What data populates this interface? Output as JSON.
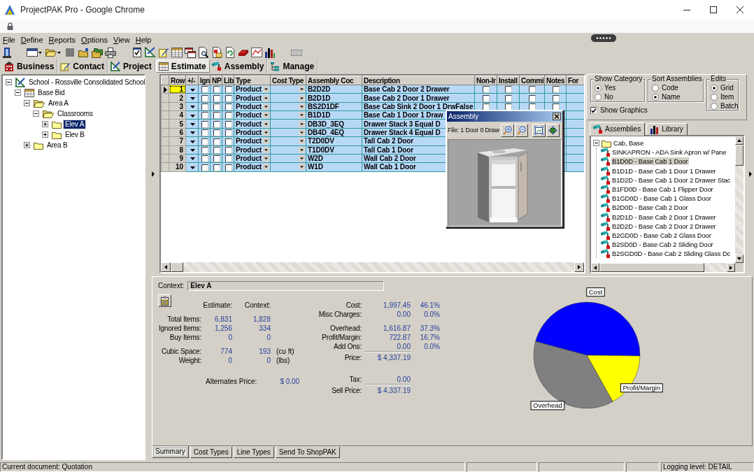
{
  "window": {
    "title": "ProjectPAK Pro - Google Chrome"
  },
  "menu": [
    "File",
    "Define",
    "Reports",
    "Options",
    "View",
    "Help"
  ],
  "module_tabs": [
    {
      "label": "Business",
      "selected": false
    },
    {
      "label": "Contact",
      "selected": false
    },
    {
      "label": "Project",
      "selected": false
    },
    {
      "label": "Estimate",
      "selected": true
    },
    {
      "label": "Assembly",
      "selected": false
    },
    {
      "label": "Manage",
      "selected": false
    }
  ],
  "project_tree": [
    {
      "label": "School - Rossville Consolidated School",
      "kind": "project",
      "expanded": true,
      "selected": false,
      "children": [
        {
          "label": "Base Bid",
          "kind": "estimate",
          "expanded": true,
          "selected": false,
          "children": [
            {
              "label": "Area A",
              "kind": "folder",
              "expanded": true,
              "selected": false,
              "children": [
                {
                  "label": "Classrooms",
                  "kind": "folder",
                  "expanded": true,
                  "selected": false,
                  "children": [
                    {
                      "label": "Elev A",
                      "kind": "folder",
                      "expanded": false,
                      "selected": true
                    },
                    {
                      "label": "Elev B",
                      "kind": "folder",
                      "expanded": false,
                      "selected": false
                    }
                  ]
                }
              ]
            },
            {
              "label": "Area B",
              "kind": "folder",
              "expanded": false,
              "selected": false
            }
          ]
        }
      ]
    }
  ],
  "grid": {
    "columns": [
      "Row",
      "+/-",
      "Ign",
      "NP",
      "Lib",
      "Type",
      "Cost Type",
      "Assembly Coc",
      "Description",
      "Non-Ir",
      "Install",
      "Commi",
      "Notes",
      "For"
    ],
    "rows": [
      {
        "row": "1",
        "selected": true,
        "ign": false,
        "np": false,
        "lib": false,
        "type": "Product",
        "code": "B2D2D",
        "description": "Base Cab 2 Door 2 Drawer",
        "flags": [
          false,
          false,
          false,
          false
        ]
      },
      {
        "row": "2",
        "selected": false,
        "ign": false,
        "np": false,
        "lib": false,
        "type": "Product",
        "code": "B2D1D",
        "description": "Base Cab 2 Door 1 Drawer",
        "flags": [
          false,
          false,
          false,
          false
        ]
      },
      {
        "row": "3",
        "selected": false,
        "ign": false,
        "np": false,
        "lib": false,
        "type": "Product",
        "code": "BS2D1DF",
        "description": "Base Cab Sink 2 Door 1 DrwFalse",
        "flags": [
          false,
          false,
          false,
          false
        ]
      },
      {
        "row": "4",
        "selected": false,
        "ign": false,
        "np": false,
        "lib": false,
        "type": "Product",
        "code": "B1D1D",
        "description": "Base Cab 1 Door 1 Draw"
      },
      {
        "row": "5",
        "selected": false,
        "ign": false,
        "np": false,
        "lib": false,
        "type": "Product",
        "code": "DB3D_3EQ",
        "description": "Drawer Stack 3 Equal D"
      },
      {
        "row": "6",
        "selected": false,
        "ign": false,
        "np": false,
        "lib": false,
        "type": "Product",
        "code": "DB4D_4EQ",
        "description": "Drawer Stack 4 Equal D"
      },
      {
        "row": "7",
        "selected": false,
        "ign": false,
        "np": false,
        "lib": false,
        "type": "Product",
        "code": "T2D0DV",
        "description": "Tall Cab 2 Door"
      },
      {
        "row": "8",
        "selected": false,
        "ign": false,
        "np": false,
        "lib": false,
        "type": "Product",
        "code": "T1D0DV",
        "description": "Tall Cab 1 Door"
      },
      {
        "row": "9",
        "selected": false,
        "ign": false,
        "np": false,
        "lib": false,
        "type": "Product",
        "code": "W2D",
        "description": "Wall Cab 2 Door"
      },
      {
        "row": "10",
        "selected": false,
        "ign": false,
        "np": false,
        "lib": false,
        "type": "Product",
        "code": "W1D",
        "description": "Wall Cab 1 Door"
      }
    ]
  },
  "assembly_window": {
    "title": "Assembly",
    "file": "File: 1 Door 0 Draw"
  },
  "option_groups": [
    {
      "title": "Show Category",
      "options": [
        {
          "label": "Yes",
          "selected": true
        },
        {
          "label": "No",
          "selected": false
        }
      ]
    },
    {
      "title": "Sort Assemblies",
      "options": [
        {
          "label": "Code",
          "selected": false
        },
        {
          "label": "Name",
          "selected": true
        }
      ]
    },
    {
      "title": "Edits",
      "options": [
        {
          "label": "Grid",
          "selected": true
        },
        {
          "label": "Item",
          "selected": false
        },
        {
          "label": "Batch",
          "selected": false
        }
      ]
    }
  ],
  "show_graphics": {
    "label": "Show Graphics",
    "checked": true
  },
  "library_tabs": [
    {
      "label": "Assemblies",
      "selected": true
    },
    {
      "label": "Library",
      "selected": false
    }
  ],
  "assembly_tree": {
    "label": "Cab, Base",
    "expanded": true,
    "selected": false,
    "children": [
      {
        "label": "SINKAPRON - ADA Sink Apron w/ Pane",
        "selected": false
      },
      {
        "label": "B1D0D - Base Cab 1 Door",
        "selected": true
      },
      {
        "label": "B1D1D - Base Cab 1 Door 1 Drawer",
        "selected": false
      },
      {
        "label": "B1D2D - Base Cab 1 Door 2 Drawer Stac",
        "selected": false
      },
      {
        "label": "B1FD0D - Base Cab 1 Flipper Door",
        "selected": false
      },
      {
        "label": "B1GD0D - Base Cab 1 Glass Door",
        "selected": false
      },
      {
        "label": "B2D0D - Base Cab 2 Door",
        "selected": false
      },
      {
        "label": "B2D1D - Base Cab 2 Door 1 Drawer",
        "selected": false
      },
      {
        "label": "B2D2D - Base Cab 2 Door 2 Drawer",
        "selected": false
      },
      {
        "label": "B2GD0D - Base Cab 2 Glass Door",
        "selected": false
      },
      {
        "label": "B2SD0D - Base Cab 2 Sliding Door",
        "selected": false
      },
      {
        "label": "B2SGD0D - Base Cab 2 Sliding Glass Dc",
        "selected": false
      }
    ]
  },
  "summary": {
    "context_label": "Context:",
    "context_value": "Elev A",
    "column_headers": [
      "Estimate:",
      "Context:"
    ],
    "item_rows": [
      {
        "label": "Total Items:",
        "estimate": "6,831",
        "context": "1,828"
      },
      {
        "label": "Ignored Items:",
        "estimate": "1,256",
        "context": "334"
      },
      {
        "label": "Buy Items:",
        "estimate": "0",
        "context": "0"
      }
    ],
    "size_rows": [
      {
        "label": "Cubic Space:",
        "estimate": "774",
        "context": "193",
        "unit": "(cu ft)"
      },
      {
        "label": "Weight:",
        "estimate": "0",
        "context": "0",
        "unit": "(lbs)"
      }
    ],
    "alternates": {
      "label": "Alternates Price:",
      "value": "$ 0.00"
    },
    "price_groups": [
      [
        {
          "kind": "item",
          "label": "Cost:",
          "value": "1,997.45",
          "percent": "46.1%"
        },
        {
          "kind": "item",
          "label": "Misc Charges:",
          "value": "0.00",
          "percent": "0.0%"
        }
      ],
      [
        {
          "kind": "item",
          "label": "Overhead:",
          "value": "1,616.87",
          "percent": "37.3%"
        },
        {
          "kind": "item",
          "label": "Profit/Margin:",
          "value": "722.87",
          "percent": "16.7%"
        },
        {
          "kind": "item",
          "label": "Add Ons:",
          "value": "0.00",
          "percent": "0.0%"
        },
        {
          "kind": "total",
          "label": "Price:",
          "value": "$ 4,337.19"
        }
      ],
      [
        {
          "kind": "item",
          "label": "Tax:",
          "value": "0.00"
        },
        {
          "kind": "total",
          "label": "Sell Price:",
          "value": "$ 4,337.19"
        }
      ]
    ],
    "chart_data": {
      "type": "pie",
      "categories": [
        "Cost",
        "Profit/Margin",
        "Overhead"
      ],
      "values": [
        46.1,
        16.7,
        37.3
      ],
      "colors": [
        "#0000ff",
        "#ffff00",
        "#808080"
      ]
    }
  },
  "bottom_tabs": [
    {
      "label": "Summary",
      "selected": true
    },
    {
      "label": "Cost Types",
      "selected": false
    },
    {
      "label": "Line Types",
      "selected": false
    },
    {
      "label": "Send To ShopPAK",
      "selected": false
    }
  ],
  "status_bar": {
    "document": "Current document: Quotation",
    "logging": "Logging level: DETAIL"
  }
}
